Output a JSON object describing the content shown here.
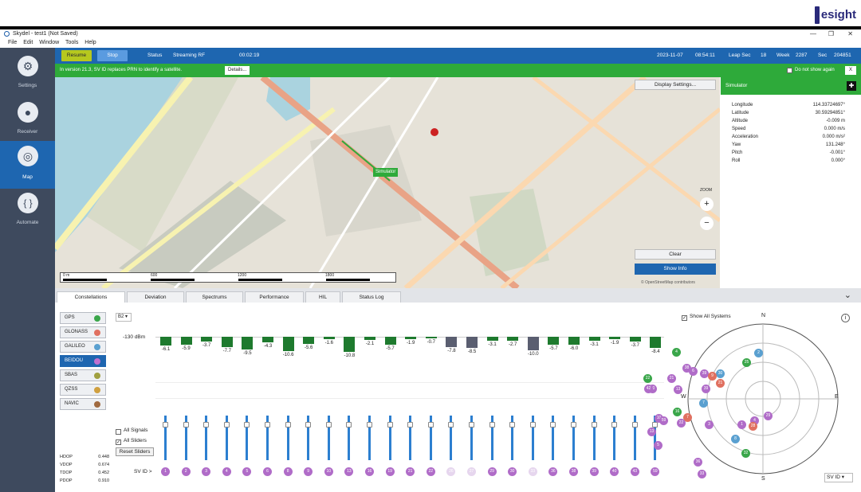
{
  "brand": {
    "logo_text": "esight"
  },
  "window": {
    "title": "Skydel - test1 (Not Saved)"
  },
  "menu": [
    "File",
    "Edit",
    "Window",
    "Tools",
    "Help"
  ],
  "sidebar": {
    "items": [
      {
        "label": "Settings",
        "icon": "gear-icon"
      },
      {
        "label": "Receiver",
        "icon": "location-pin-icon"
      },
      {
        "label": "Map",
        "icon": "map-icon"
      },
      {
        "label": "Automate",
        "icon": "braces-icon"
      }
    ]
  },
  "toolbar": {
    "resume_label": "Resume",
    "stop_label": "Stop",
    "status_label": "Status",
    "status_value": "Streaming RF",
    "elapsed": "00:02:19",
    "date": "2023-11-07",
    "time": "08:54:11",
    "leap_label": "Leap Sec",
    "leap_value": "18",
    "week_label": "Week",
    "week_value": "2287",
    "sec_label": "Sec",
    "sec_value": "204851"
  },
  "infobar": {
    "message": "In version 21.3, SV ID replaces PRN to identify a satellite.",
    "details_label": "Details...",
    "dont_show_label": "Do not show again",
    "close_label": "X"
  },
  "map": {
    "display_settings_label": "Display Settings...",
    "simulator_marker": "Simulator",
    "zoom_label": "ZOOM",
    "zoom_in": "+",
    "zoom_out": "−",
    "clear_label": "Clear",
    "show_info_label": "Show Info",
    "attribution": "© OpenStreetMap contributors",
    "scale_ticks": [
      "0 m",
      "600",
      "1200",
      "1800"
    ]
  },
  "sim_panel": {
    "title": "Simulator",
    "rows": [
      {
        "label": "Longitude",
        "value": "114.33724697°"
      },
      {
        "label": "Latitude",
        "value": "30.59294851°"
      },
      {
        "label": "Altitude",
        "value": "-0.009 m"
      },
      {
        "label": "Speed",
        "value": "0.000 m/s"
      },
      {
        "label": "Acceleration",
        "value": "0.000 m/s²"
      },
      {
        "label": "Yaw",
        "value": "131.248°"
      },
      {
        "label": "Pitch",
        "value": "-0.001°"
      },
      {
        "label": "Roll",
        "value": "0.000°"
      }
    ]
  },
  "tabs": [
    "Constellations",
    "Deviation",
    "Spectrums",
    "Performance",
    "HIL",
    "Status Log"
  ],
  "constellations": [
    {
      "label": "GPS",
      "color": "#3aa64a"
    },
    {
      "label": "GLONASS",
      "color": "#e07060"
    },
    {
      "label": "GALILEO",
      "color": "#5aa0d0"
    },
    {
      "label": "BEIDOU",
      "color": "#c070d0"
    },
    {
      "label": "SBAS",
      "color": "#a0a040"
    },
    {
      "label": "QZSS",
      "color": "#d0a040"
    },
    {
      "label": "NAVIC",
      "color": "#a06a40"
    }
  ],
  "signal_select": "B2",
  "dbm_label": "-130 dBm",
  "bars": [
    {
      "v": "-6.1",
      "h": 11,
      "c": "#1e7a2e"
    },
    {
      "v": "-5.9",
      "h": 10,
      "c": "#1e7a2e"
    },
    {
      "v": "-3.7",
      "h": 6,
      "c": "#1e7a2e"
    },
    {
      "v": "-7.7",
      "h": 13,
      "c": "#1e7a2e"
    },
    {
      "v": "-9.5",
      "h": 16,
      "c": "#1e7a2e"
    },
    {
      "v": "-4.3",
      "h": 7,
      "c": "#1e7a2e"
    },
    {
      "v": "-10.6",
      "h": 18,
      "c": "#1e7a2e"
    },
    {
      "v": "-5.6",
      "h": 9,
      "c": "#1e7a2e"
    },
    {
      "v": "-1.6",
      "h": 3,
      "c": "#1e7a2e"
    },
    {
      "v": "-10.8",
      "h": 19,
      "c": "#1e7a2e"
    },
    {
      "v": "-2.1",
      "h": 4,
      "c": "#1e7a2e"
    },
    {
      "v": "-5.7",
      "h": 10,
      "c": "#1e7a2e"
    },
    {
      "v": "-1.9",
      "h": 3,
      "c": "#1e7a2e"
    },
    {
      "v": "-0.7",
      "h": 2,
      "c": "#1e7a2e"
    },
    {
      "v": "-7.8",
      "h": 13,
      "c": "#5a5e70"
    },
    {
      "v": "-8.5",
      "h": 14,
      "c": "#5a5e70"
    },
    {
      "v": "-3.1",
      "h": 5,
      "c": "#1e7a2e"
    },
    {
      "v": "-2.7",
      "h": 5,
      "c": "#1e7a2e"
    },
    {
      "v": "-10.0",
      "h": 17,
      "c": "#5a5e70"
    },
    {
      "v": "-5.7",
      "h": 10,
      "c": "#1e7a2e"
    },
    {
      "v": "-6.0",
      "h": 10,
      "c": "#1e7a2e"
    },
    {
      "v": "-3.1",
      "h": 5,
      "c": "#1e7a2e"
    },
    {
      "v": "-1.9",
      "h": 3,
      "c": "#1e7a2e"
    },
    {
      "v": "-3.7",
      "h": 6,
      "c": "#1e7a2e"
    },
    {
      "v": "-8.4",
      "h": 14,
      "c": "#1e7a2e"
    }
  ],
  "sv_ids": [
    {
      "id": "1",
      "f": false
    },
    {
      "id": "2",
      "f": false
    },
    {
      "id": "3",
      "f": false
    },
    {
      "id": "4",
      "f": false
    },
    {
      "id": "5",
      "f": false
    },
    {
      "id": "6",
      "f": false
    },
    {
      "id": "8",
      "f": false
    },
    {
      "id": "9",
      "f": false
    },
    {
      "id": "10",
      "f": false
    },
    {
      "id": "13",
      "f": false
    },
    {
      "id": "16",
      "f": false
    },
    {
      "id": "19",
      "f": false
    },
    {
      "id": "21",
      "f": false
    },
    {
      "id": "22",
      "f": false
    },
    {
      "id": "26",
      "f": true
    },
    {
      "id": "27",
      "f": true
    },
    {
      "id": "29",
      "f": false
    },
    {
      "id": "30",
      "f": false
    },
    {
      "id": "33",
      "f": true
    },
    {
      "id": "36",
      "f": false
    },
    {
      "id": "38",
      "f": false
    },
    {
      "id": "39",
      "f": false
    },
    {
      "id": "40",
      "f": false
    },
    {
      "id": "43",
      "f": false
    },
    {
      "id": "59",
      "f": false
    }
  ],
  "controls": {
    "all_signals": "All Signals",
    "all_sliders": "All Sliders",
    "reset_sliders": "Reset Sliders",
    "sv_id_label": "SV ID >"
  },
  "dop": [
    {
      "label": "HDOP",
      "value": "0.448"
    },
    {
      "label": "VDOP",
      "value": "0.674"
    },
    {
      "label": "TDOP",
      "value": "0.452"
    },
    {
      "label": "PDOP",
      "value": "0.910"
    }
  ],
  "skyplot": {
    "show_all_label": "Show All Systems",
    "n": "N",
    "e": "E",
    "s": "S",
    "w": "W",
    "sv_select": "SV ID",
    "sats": [
      {
        "id": "4",
        "c": "#3aa64a"
      },
      {
        "id": "2",
        "c": "#5aa0d0"
      },
      {
        "id": "25",
        "c": "#3aa64a"
      },
      {
        "id": "38",
        "c": "#b06cc8"
      },
      {
        "id": "6",
        "c": "#b06cc8"
      },
      {
        "id": "39",
        "c": "#b06cc8"
      },
      {
        "id": "30",
        "c": "#5aa0d0"
      },
      {
        "id": "9",
        "c": "#e07060"
      },
      {
        "id": "21",
        "c": "#e07060"
      },
      {
        "id": "22",
        "c": "#3aa64a"
      },
      {
        "id": "21",
        "c": "#b06cc8"
      },
      {
        "id": "40",
        "c": "#b06cc8"
      },
      {
        "id": "42",
        "c": "#b06cc8"
      },
      {
        "id": "13",
        "c": "#b06cc8"
      },
      {
        "id": "39",
        "c": "#b06cc8"
      },
      {
        "id": "7",
        "c": "#5aa0d0"
      },
      {
        "id": "10",
        "c": "#b06cc8"
      },
      {
        "id": "16",
        "c": "#3aa64a"
      },
      {
        "id": "7",
        "c": "#e07060"
      },
      {
        "id": "22",
        "c": "#b06cc8"
      },
      {
        "id": "59",
        "c": "#b06cc8"
      },
      {
        "id": "3",
        "c": "#b06cc8"
      },
      {
        "id": "4",
        "c": "#b06cc8"
      },
      {
        "id": "1",
        "c": "#b06cc8"
      },
      {
        "id": "28",
        "c": "#e07060"
      },
      {
        "id": "8",
        "c": "#5aa0d0"
      },
      {
        "id": "29",
        "c": "#b06cc8"
      },
      {
        "id": "13",
        "c": "#b06cc8"
      },
      {
        "id": "32",
        "c": "#3aa64a"
      },
      {
        "id": "36",
        "c": "#b06cc8"
      },
      {
        "id": "5",
        "c": "#b06cc8"
      },
      {
        "id": "33",
        "c": "#b06cc8"
      }
    ]
  }
}
